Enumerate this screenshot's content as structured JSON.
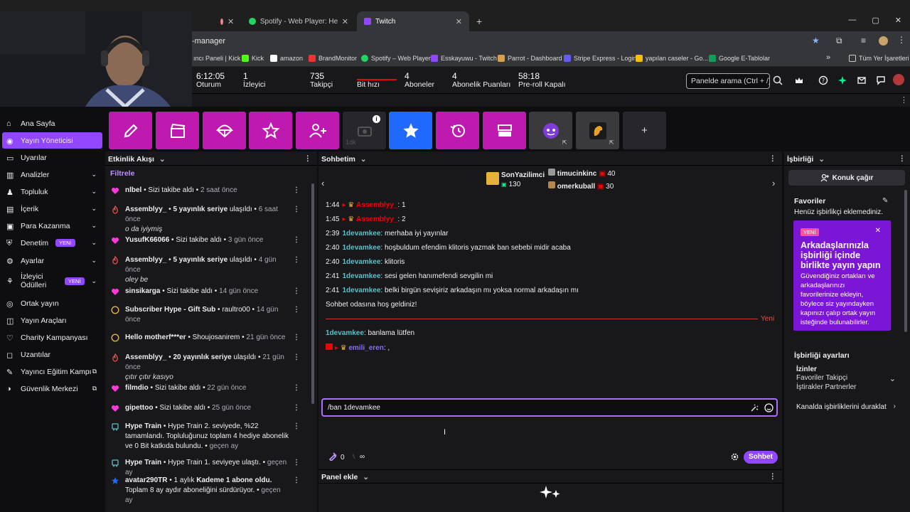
{
  "browser": {
    "tabs": [
      {
        "label": "",
        "icon": "recording-icon"
      },
      {
        "label": "Spotify - Web Player: Herkes için",
        "icon": "spotify-icon"
      },
      {
        "label": "Twitch",
        "icon": "twitch-icon"
      }
    ],
    "new_tab": "+",
    "url": "-manager",
    "bookmarks": [
      "ıncı Paneli | Kick",
      "Kick",
      "amazon",
      "BrandMonitor",
      "Spotify – Web Player",
      "Esskayuwu - Twitch",
      "Parrot - Dashboard",
      "Stripe Express - Login",
      "yapılan caseler - Go...",
      "Google E-Tablolar"
    ],
    "bookmarks_more": "»",
    "all_bookmarks": "Tüm Yer İşaretleri"
  },
  "header": {
    "stats": [
      {
        "value": "6:12:05",
        "label": "Oturum"
      },
      {
        "value": "1",
        "label": "İzleyici"
      },
      {
        "value": "735",
        "label": "Takipçi"
      },
      {
        "value": "",
        "label": "Bit hızı"
      },
      {
        "value": "4",
        "label": "Aboneler"
      },
      {
        "value": "4",
        "label": "Abonelik Puanları"
      },
      {
        "value": "58:18",
        "label": "Pre-roll Kapalı"
      }
    ],
    "search_placeholder": "Panelde arama (Ctrl + /)"
  },
  "sidebar": {
    "items": [
      {
        "label": "Ana Sayfa",
        "icon": "home-icon",
        "active": false
      },
      {
        "label": "Yayın Yöneticisi",
        "icon": "broadcast-icon",
        "active": true
      },
      {
        "label": "Uyarılar",
        "icon": "alert-icon"
      },
      {
        "label": "Analizler",
        "icon": "analytics-icon",
        "chevron": true
      },
      {
        "label": "Topluluk",
        "icon": "community-icon",
        "chevron": true
      },
      {
        "label": "İçerik",
        "icon": "content-icon",
        "chevron": true
      },
      {
        "label": "Para Kazanma",
        "icon": "monetization-icon",
        "chevron": true
      },
      {
        "label": "Denetim",
        "icon": "moderation-icon",
        "chevron": true,
        "badge": "YENİ"
      },
      {
        "label": "Ayarlar",
        "icon": "settings-icon",
        "chevron": true
      },
      {
        "label": "İzleyici Ödülleri",
        "icon": "rewards-icon",
        "chevron": true,
        "badge": "YENİ"
      },
      {
        "label": "Ortak yayın",
        "icon": "collab-icon"
      },
      {
        "label": "Yayın Araçları",
        "icon": "tools-icon"
      },
      {
        "label": "Charity Kampanyası",
        "icon": "charity-icon"
      },
      {
        "label": "Uzantılar",
        "icon": "extensions-icon"
      },
      {
        "label": "Yayıncı Eğitim Kampı",
        "icon": "learning-icon",
        "external": true
      },
      {
        "label": "Güvenlik Merkezi",
        "icon": "safety-icon",
        "external": true
      }
    ]
  },
  "quick_actions": {
    "disabled_label": "1dk",
    "add": "+"
  },
  "activity": {
    "title": "Etkinlik Akışı",
    "filter": "Filtrele",
    "items": [
      {
        "type": "follow",
        "user": "nlbel",
        "text": "Sizi takibe aldı",
        "time": "2 saat önce"
      },
      {
        "type": "streak",
        "user": "Assemblyy_",
        "text": "5 yayınlık seriye",
        "after": "ulaşıldı",
        "time": "6 saat önce",
        "quote": "o da iyiymiş"
      },
      {
        "type": "follow",
        "user": "YusufK66066",
        "text": "Sizi takibe aldı",
        "time": "3 gün önce"
      },
      {
        "type": "streak",
        "user": "Assemblyy_",
        "text": "5 yayınlık seriye",
        "after": "ulaşıldı",
        "time": "4 gün önce",
        "quote": "oley be"
      },
      {
        "type": "follow",
        "user": "sinsikarga",
        "text": "Sizi takibe aldı",
        "time": "14 gün önce"
      },
      {
        "type": "hype",
        "user": "Subscriber Hype - Gift Sub",
        "text": "raultro00",
        "time": "14 gün önce"
      },
      {
        "type": "hype",
        "user": "Hello motherf***er",
        "text": "Shoujosanirem",
        "time": "21 gün önce"
      },
      {
        "type": "streak",
        "user": "Assemblyy_",
        "text": "20 yayınlık seriye",
        "after": "ulaşıldı",
        "time": "21 gün önce",
        "quote": "çıtır çıtır kasıyo"
      },
      {
        "type": "follow",
        "user": "filmdio",
        "text": "Sizi takibe aldı",
        "time": "22 gün önce"
      },
      {
        "type": "follow",
        "user": "gipettoo",
        "text": "Sizi takibe aldı",
        "time": "25 gün önce"
      },
      {
        "type": "train",
        "user": "Hype Train",
        "text": "Hype Train 2. seviyede, %22 tamamlandı. Topluluğunuz toplam 4 hediye abonelik ve 0 Bit katkıda bulundu.",
        "time": "geçen ay"
      },
      {
        "type": "train",
        "user": "Hype Train",
        "text": "Hype Train 1. seviyeye ulaştı.",
        "time": "geçen ay"
      },
      {
        "type": "sub",
        "user": "avatar290TR",
        "text": "1 aylık",
        "tier": "Kademe 1 abone oldu.",
        "sub2": "Toplam 8 ay aydır aboneliğini sürdürüyor.",
        "time": "geçen ay"
      }
    ]
  },
  "chat": {
    "title": "Sohbetim",
    "leaderboard": [
      {
        "name": "SonYazilimci",
        "value": "130"
      },
      {
        "name": "timucinkinc",
        "value": "40"
      },
      {
        "name": "omerkuball",
        "value": "30"
      }
    ],
    "messages": [
      {
        "time": "1:44",
        "user": "Assemblyy_",
        "text": "1",
        "color": "u2",
        "badges": true
      },
      {
        "time": "1:45",
        "user": "Assemblyy_",
        "text": "2",
        "color": "u2",
        "badges": true
      },
      {
        "time": "2:39",
        "user": "1devamkee",
        "text": "merhaba iyi yayınlar",
        "color": "u1"
      },
      {
        "time": "2:40",
        "user": "1devamkee",
        "text": "hoşbuldum efendim klitoris yazmak ban sebebi midir acaba",
        "color": "u1"
      },
      {
        "time": "2:40",
        "user": "1devamkee",
        "text": "klitoris",
        "color": "u1"
      },
      {
        "time": "2:41",
        "user": "1devamkee",
        "text": "sesi gelen hanımefendi sevgilin mi",
        "color": "u1"
      },
      {
        "time": "2:41",
        "user": "1devamkee",
        "text": "belki birgün sevişiriz arkadaşın mı yoksa normal arkadaşın mı",
        "color": "u1"
      }
    ],
    "welcome": "Sohbet odasına hoş geldiniz!",
    "new_label": "Yeni",
    "after": [
      {
        "user": "1devamkee",
        "text": "banlama lütfen",
        "color": "u1"
      },
      {
        "user": "emili_eren",
        "text": ",",
        "color": "u3",
        "badges": true
      }
    ],
    "input_value": "/ban 1devamkee",
    "points": "0",
    "points2": "∞",
    "send": "Sohbet",
    "panel_add": "Panel ekle"
  },
  "collab": {
    "title": "İşbirliği",
    "invite": "Konuk çağır",
    "favorites_title": "Favoriler",
    "favorites_empty": "Henüz işbirlikçi eklemediniz.",
    "promo_badge": "YENİ",
    "promo_title": "Arkadaşlarınızla işbirliği içinde birlikte yayın yapın",
    "promo_text": "Güvendiğiniz ortakları ve arkadaşlarınızı favorilerinize ekleyin, böylece siz yayındayken kapınızı çalıp ortak yayın isteğinde bulunabilirler.",
    "settings_title": "İşbirliği ayarları",
    "perm_title": "İzinler",
    "perm_text": "Favoriler Takipçi İştirakler Partnerler",
    "pause": "Kanalda işbirliklerini duraklat"
  },
  "colors": {
    "accent": "#9147ff",
    "pink": "#bf1ab0",
    "blue": "#1f69ff"
  }
}
